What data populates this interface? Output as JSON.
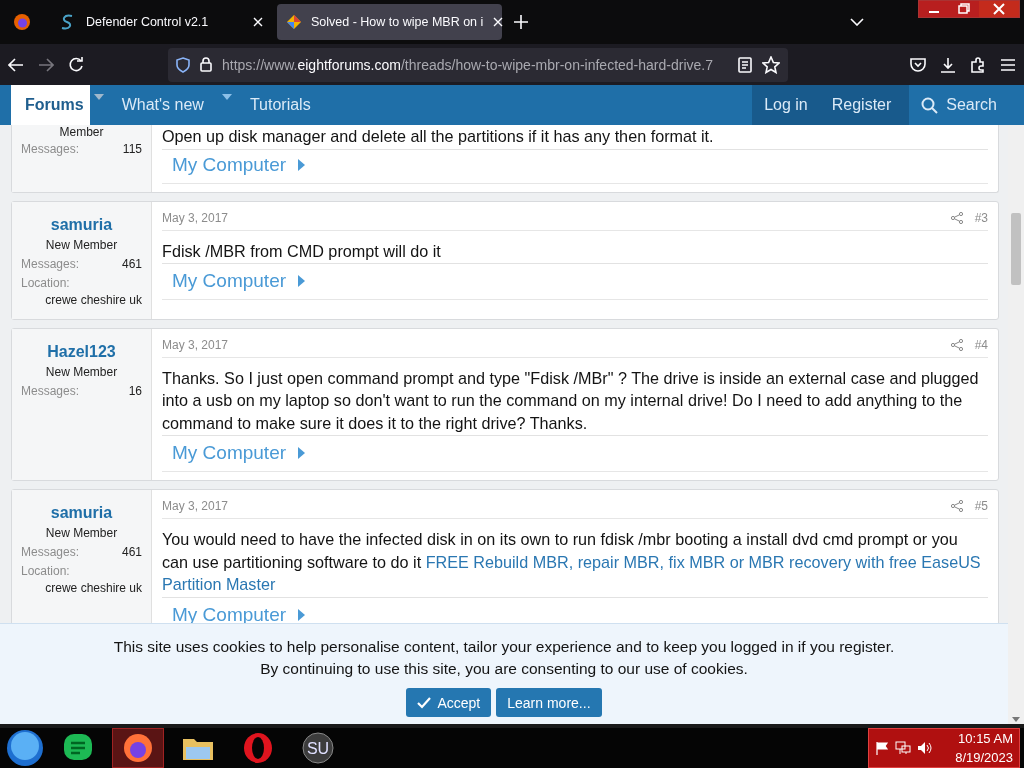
{
  "browser": {
    "tabs": [
      {
        "title": "Defender Control v2.1",
        "selected": false
      },
      {
        "title": "Solved - How to wipe MBR on i",
        "selected": true
      }
    ],
    "url": [
      {
        "text": "https://www.",
        "kind": "dim"
      },
      {
        "text": "eightforums.com",
        "kind": "host"
      },
      {
        "text": "/threads/how-to-wipe-mbr-on-infected-hard-drive.7",
        "kind": "dim"
      }
    ]
  },
  "nav": {
    "items": [
      {
        "label": "Forums",
        "selected": true,
        "dropdown": true
      },
      {
        "label": "What's new",
        "selected": false,
        "dropdown": true
      },
      {
        "label": "Tutorials",
        "selected": false,
        "dropdown": false
      }
    ],
    "account": [
      "Log in",
      "Register"
    ],
    "search": "Search"
  },
  "posts": [
    {
      "user": {
        "title": "Member",
        "stats": [
          {
            "label": "Messages:",
            "value": "115"
          }
        ]
      },
      "message": [
        {
          "text": "Open up disk manager and delete all the partitions if it has any then format it.",
          "link": false
        }
      ],
      "signature": "My Computer"
    },
    {
      "user": {
        "name": "samuria",
        "title": "New Member",
        "stats": [
          {
            "label": "Messages:",
            "value": "461"
          },
          {
            "label": "Location:",
            "value": "crewe cheshire uk"
          }
        ]
      },
      "date": "May 3, 2017",
      "number": "#3",
      "message": [
        {
          "text": "Fdisk /MBR from CMD prompt will do it",
          "link": false
        }
      ],
      "signature": "My Computer"
    },
    {
      "user": {
        "name": "Hazel123",
        "title": "New Member",
        "stats": [
          {
            "label": "Messages:",
            "value": "16"
          }
        ]
      },
      "date": "May 3, 2017",
      "number": "#4",
      "message": [
        {
          "text": "Thanks. So I just open command prompt and type \"Fdisk /MBr\" ? The drive is inside an external case and plugged into a usb on my laptop so don't want to run the command on my internal drive! Do I need to add anything to the command to make sure it does it to the right drive? Thanks.",
          "link": false
        }
      ],
      "signature": "My Computer"
    },
    {
      "user": {
        "name": "samuria",
        "title": "New Member",
        "stats": [
          {
            "label": "Messages:",
            "value": "461"
          },
          {
            "label": "Location:",
            "value": "crewe cheshire uk"
          }
        ]
      },
      "date": "May 3, 2017",
      "number": "#5",
      "message": [
        {
          "text": "You would need to have the infected disk in on its own to run fdisk /mbr booting a install dvd cmd prompt or you can use partitioning software to do it",
          "link": false
        },
        {
          "text": "FREE Rebuild MBR, repair MBR, fix MBR or MBR recovery with free EaseUS",
          "link": true
        },
        {
          "text": "Partition Master",
          "link": true
        }
      ],
      "signature": "My Computer"
    }
  ],
  "cookie_notice": {
    "lines": [
      "This site uses cookies to help personalise content, tailor your experience and to keep you logged in if you register.",
      "By continuing to use this site, you are consenting to our use of cookies."
    ],
    "buttons": [
      {
        "label": "Accept",
        "kind": "accept"
      },
      {
        "label": "Learn more...",
        "kind": "plain"
      }
    ]
  },
  "taskbar": {
    "apps": [
      {
        "kind": "chat",
        "active": false
      },
      {
        "kind": "firefox",
        "active": true
      },
      {
        "kind": "folder",
        "active": false
      },
      {
        "kind": "opera",
        "active": false
      },
      {
        "kind": "su",
        "active": false,
        "label": "SU"
      }
    ],
    "time": "10:15 AM",
    "date": "8/19/2023"
  }
}
